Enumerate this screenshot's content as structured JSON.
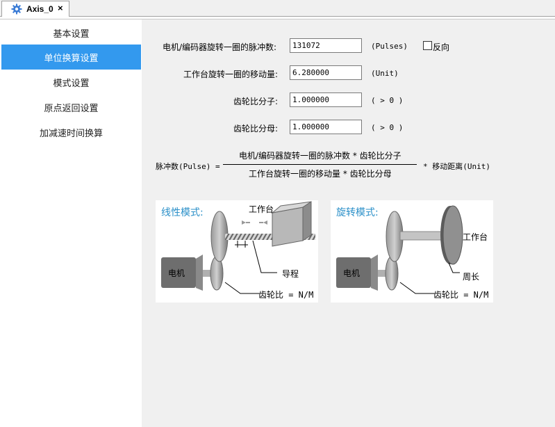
{
  "tab": {
    "title": "Axis_0",
    "close": "×",
    "icon": "gear-icon"
  },
  "sidebar": {
    "items": [
      {
        "label": "基本设置"
      },
      {
        "label": "单位换算设置"
      },
      {
        "label": "模式设置"
      },
      {
        "label": "原点返回设置"
      },
      {
        "label": "加减速时间换算"
      }
    ],
    "active_index": 1,
    "accent_color": "#3399ee"
  },
  "form": {
    "pulses_label": "电机/编码器旋转一圈的脉冲数:",
    "pulses_value": "131072",
    "pulses_unit": "(Pulses)",
    "reverse_label": "反向",
    "reverse_checked": false,
    "move_label": "工作台旋转一圈的移动量:",
    "move_value": "6.280000",
    "move_unit": "(Unit)",
    "num_label": "齿轮比分子:",
    "num_value": "1.000000",
    "num_unit": "( > 0 )",
    "den_label": "齿轮比分母:",
    "den_value": "1.000000",
    "den_unit": "( > 0 )"
  },
  "formula": {
    "lhs": "脉冲数(Pulse) =",
    "numerator": "电机/编码器旋转一圈的脉冲数 * 齿轮比分子",
    "denominator": "工作台旋转一圈的移动量 * 齿轮比分母",
    "rhs": "*  移动距离(Unit)"
  },
  "linear_diagram": {
    "title": "线性模式:",
    "worktable": "工作台",
    "motor": "电机",
    "lead": "导程",
    "gear_ratio": "齿轮比 = N/M"
  },
  "rotary_diagram": {
    "title": "旋转模式:",
    "worktable": "工作台",
    "motor": "电机",
    "circumference": "周长",
    "gear_ratio": "齿轮比 = N/M"
  }
}
